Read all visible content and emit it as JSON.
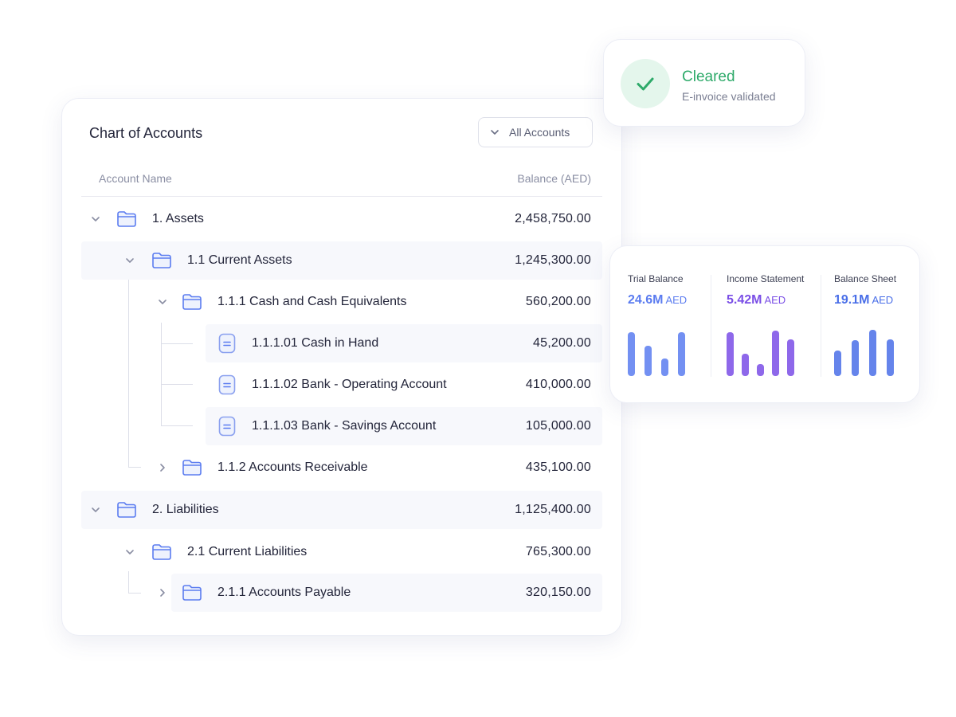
{
  "coa": {
    "title": "Chart of Accounts",
    "filter_label": "All Accounts",
    "col_name": "Account Name",
    "col_balance": "Balance (AED)",
    "rows": [
      {
        "name": "1. Assets",
        "balance": "2,458,750.00"
      },
      {
        "name": "1.1 Current Assets",
        "balance": "1,245,300.00"
      },
      {
        "name": "1.1.1 Cash and Cash Equivalents",
        "balance": "560,200.00"
      },
      {
        "name": "1.1.1.01 Cash in Hand",
        "balance": "45,200.00"
      },
      {
        "name": "1.1.1.02 Bank - Operating Account",
        "balance": "410,000.00"
      },
      {
        "name": "1.1.1.03 Bank - Savings Account",
        "balance": "105,000.00"
      },
      {
        "name": "1.1.2 Accounts Receivable",
        "balance": "435,100.00"
      },
      {
        "name": "2. Liabilities",
        "balance": "1,125,400.00"
      },
      {
        "name": "2.1 Current Liabilities",
        "balance": "765,300.00"
      },
      {
        "name": "2.1.1 Accounts Payable",
        "balance": "320,150.00"
      }
    ]
  },
  "cleared": {
    "title": "Cleared",
    "subtitle": "E-invoice validated",
    "icon": "check-icon",
    "color": "#2eaa6a"
  },
  "reports": [
    {
      "label": "Trial Balance",
      "value": "24.6M",
      "unit": "AED",
      "color": "#5b7cf0",
      "bars": [
        0.95,
        0.65,
        0.38,
        0.95
      ]
    },
    {
      "label": "Income Statement",
      "value": "5.42M",
      "unit": "AED",
      "color": "#7a4ee6",
      "bars": [
        0.95,
        0.48,
        0.25,
        0.98,
        0.8
      ]
    },
    {
      "label": "Balance Sheet",
      "value": "19.1M",
      "unit": "AED",
      "color": "#4a6fe8",
      "bars": [
        0.55,
        0.78,
        1.0,
        0.8
      ]
    }
  ]
}
